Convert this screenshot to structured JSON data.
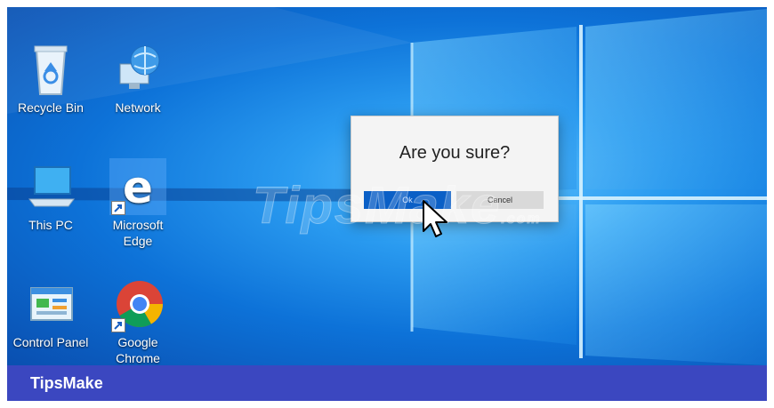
{
  "desktop": {
    "icons": [
      {
        "label": "Recycle Bin"
      },
      {
        "label": "Network"
      },
      {
        "label": "This PC"
      },
      {
        "label": "Microsoft Edge"
      },
      {
        "label": "Control Panel"
      },
      {
        "label": "Google Chrome"
      }
    ]
  },
  "dialog": {
    "message": "Are you sure?",
    "ok_label": "Ok",
    "cancel_label": "Cancel"
  },
  "watermark": {
    "text": "TipsMake",
    "suffix": ".com"
  },
  "footer": {
    "brand": "TipsMake"
  },
  "colors": {
    "accent": "#0a5fc6",
    "footer": "#3b47c0",
    "desktop": "#0d72d8"
  }
}
